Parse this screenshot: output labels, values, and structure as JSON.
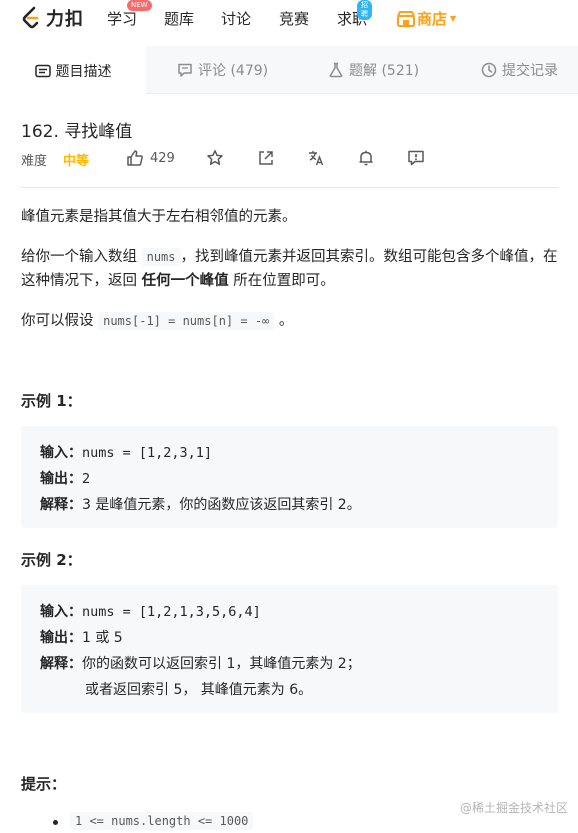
{
  "nav": {
    "logo_text": "力扣",
    "items": [
      "学习",
      "题库",
      "讨论",
      "竞赛",
      "求职"
    ],
    "badge_new": "NEW",
    "badge_hire": "招聘",
    "store": "商店"
  },
  "tabs": [
    {
      "label": "题目描述"
    },
    {
      "label": "评论 (479)"
    },
    {
      "label": "题解 (521)"
    },
    {
      "label": "提交记录"
    }
  ],
  "problem": {
    "title": "162. 寻找峰值",
    "difficulty_label": "难度",
    "difficulty": "中等",
    "likes": "429"
  },
  "description": {
    "p1": "峰值元素是指其值大于左右相邻值的元素。",
    "p2_a": "给你一个输入数组 ",
    "p2_code": "nums",
    "p2_b": "，找到峰值元素并返回其索引。数组可能包含多个峰值，在这种情况下，返回 ",
    "p2_bold": "任何一个峰值",
    "p2_c": " 所在位置即可。",
    "p3_a": "你可以假设 ",
    "p3_code": "nums[-1] = nums[n] = -∞",
    "p3_b": " 。"
  },
  "example1": {
    "heading": "示例 1：",
    "input_label": "输入：",
    "input": "nums = [1,2,3,1]",
    "output_label": "输出：",
    "output": "2",
    "explain_label": "解释：",
    "explain": "3 是峰值元素，你的函数应该返回其索引 2。"
  },
  "example2": {
    "heading": "示例 2：",
    "input_label": "输入：",
    "input": "nums = [1,2,1,3,5,6,4]",
    "output_label": "输出：",
    "output": "1 或 5",
    "explain_label": "解释：",
    "explain": "你的函数可以返回索引 1，其峰值元素为 2；",
    "explain2": "或者返回索引 5， 其峰值元素为 6。"
  },
  "hints": {
    "heading": "提示：",
    "item1": "1 <= nums.length <= 1000"
  },
  "watermark": "@稀土掘金技术社区",
  "colors": {
    "accent": "#ffa116",
    "medium": "#ffb800"
  }
}
